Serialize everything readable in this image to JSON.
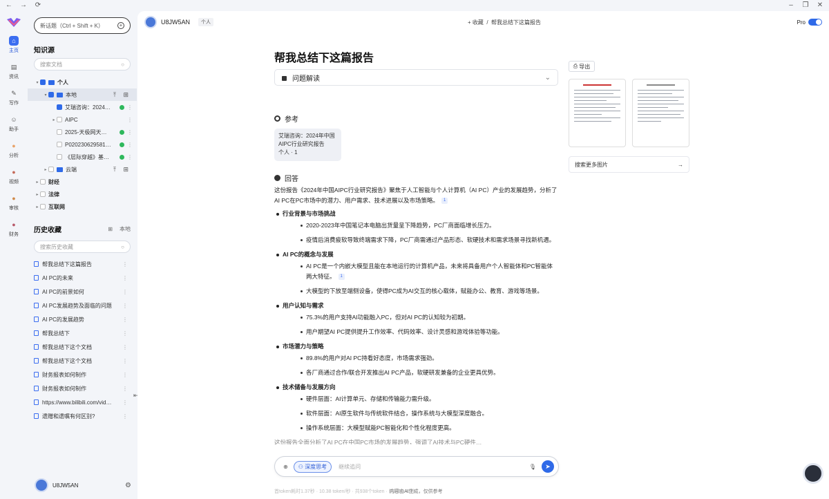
{
  "window": {
    "back": "←",
    "forward": "→",
    "refresh": "⟳",
    "min": "–",
    "max": "❐",
    "close": "✕"
  },
  "rail": [
    {
      "label": "主页",
      "icon": "home-icon",
      "glyph": "⌂",
      "active": true
    },
    {
      "label": "资讯",
      "icon": "news-icon",
      "glyph": "▤"
    },
    {
      "label": "写作",
      "icon": "pen-icon",
      "glyph": "✎"
    },
    {
      "label": "助手",
      "icon": "robot-icon",
      "glyph": "☺"
    },
    {
      "label": "分析",
      "icon": "analysis-avatar",
      "glyph": "●"
    },
    {
      "label": "视频",
      "icon": "video-avatar",
      "glyph": "●"
    },
    {
      "label": "审核",
      "icon": "review-avatar",
      "glyph": "●"
    },
    {
      "label": "财务",
      "icon": "finance-avatar",
      "glyph": "●"
    }
  ],
  "sidebar": {
    "new_chat": "新话题（Ctrl + Shift + K）",
    "kb_title": "知识源",
    "kb_search_placeholder": "搜索文档",
    "tree": [
      {
        "label": "个人",
        "bold": true,
        "indent": 1
      },
      {
        "label": "本地",
        "indent": 2,
        "selected": true
      },
      {
        "label": "艾瑞咨询：2024…",
        "indent": 3,
        "checked": true,
        "status": true
      },
      {
        "label": "AIPC",
        "indent": 3,
        "folder": true
      },
      {
        "label": "2025-天极网天…",
        "indent": 3,
        "status": true
      },
      {
        "label": "P020230629581…",
        "indent": 3,
        "status": true
      },
      {
        "label": "《层际穿越》基…",
        "indent": 3,
        "status": true
      },
      {
        "label": "云端",
        "indent": 2,
        "folder": true
      },
      {
        "label": "财经",
        "bold": true,
        "indent": 1
      },
      {
        "label": "法律",
        "bold": true,
        "indent": 1
      },
      {
        "label": "互联网",
        "bold": true,
        "indent": 1
      }
    ],
    "history_title": "历史收藏",
    "history_scope": "本地",
    "history_search_placeholder": "搜索历史收藏",
    "history": [
      "帮我总结下这篇报告",
      "AI PC的未来",
      "AI PC的前景如何",
      "AI PC发展趋势及面临的问题",
      "AI PC的发展趋势",
      "帮我总结下",
      "帮我总结下这个文档",
      "帮我总结下这个文档",
      "财务报表如何制作",
      "财务报表如何制作",
      "https://www.bilibili.com/vid…",
      "遗赠和遗嘱有何区别?"
    ],
    "user": "U8JW5AN"
  },
  "topbar": {
    "user": "U8JW5AN",
    "tag": "个人",
    "breadcrumb_add": "+ 收藏",
    "breadcrumb_sep": "/",
    "breadcrumb_title": "帮我总结下这篇报告",
    "pro_label": "Pro",
    "pro_on": true
  },
  "main": {
    "title": "帮我总结下这篇报告",
    "dropdown_label": "问题解读",
    "ref_heading": "参考",
    "ref_card_title": "艾瑞咨询：2024年中国AIPC行业研究报告",
    "ref_card_meta": "个人 · 1",
    "answer_heading": "回答",
    "intro": "这份报告《2024年中国AIPC行业研究报告》聚焦于人工智能与个人计算机（AI PC）产业的发展趋势，分析了AI PC在PC市场中的潜力、用户需求、技术进展以及市场策略。",
    "intro_badge": "1",
    "sections": [
      {
        "title": "行业背景与市场挑战",
        "items": [
          {
            "text": "2020-2023年中国笔记本电脑出货量呈下降趋势，PC厂商面临增长压力。"
          },
          {
            "text": "疫情后消费疲软导致终端需求下降，PC厂商需通过产品形态、软硬技术和需求场景寻找新机遇。"
          }
        ]
      },
      {
        "title": "AI PC的概念与发展",
        "items": [
          {
            "text": "AI PC是一个内嵌大模型且能在本地运行的计算机产品，未来将具备用户个人智能体和PC智能体两大特征。",
            "badge": "1"
          },
          {
            "text": "大模型的下放至端侧设备，使得PC成为AI交互的核心载体，赋能办公、教育、游戏等场景。"
          }
        ]
      },
      {
        "title": "用户认知与需求",
        "items": [
          {
            "text": "75.3%的用户支持AI功能融入PC，但对AI PC的认知较为初期。"
          },
          {
            "text": "用户期望AI PC提供提升工作效率、代码效率、设计灵感和游戏体验等功能。"
          }
        ]
      },
      {
        "title": "市场潜力与策略",
        "items": [
          {
            "text": "89.8%的用户对AI PC持看好态度，市场需求强劲。"
          },
          {
            "text": "各厂商通过合作/联合开发推出AI PC产品，软硬研发兼备的企业更具优势。"
          }
        ]
      },
      {
        "title": "技术储备与发展方向",
        "items": [
          {
            "text": "硬件层面：AI计算单元、存储和传输能力需升级。"
          },
          {
            "text": "软件层面：AI原生软件与传统软件结合，操作系统与大模型深度融合。"
          },
          {
            "text": "操作系统层面：大模型赋能PC智能化和个性化程度更高。"
          }
        ]
      }
    ],
    "trailing": "这份报告全面分析了AI PC在中国PC市场的发展趋势，强调了AI技术与PC硬件…",
    "export_label": "导出",
    "more_images": "搜索更多图片"
  },
  "input": {
    "deep_label": "深度思考",
    "placeholder": "继续追问"
  },
  "footer": {
    "stats": "首token耗时1.37秒 · 10.38 token/秒 · 共938个token · 耗时90.41秒",
    "notice": "内容由AI生成，仅供参考"
  }
}
